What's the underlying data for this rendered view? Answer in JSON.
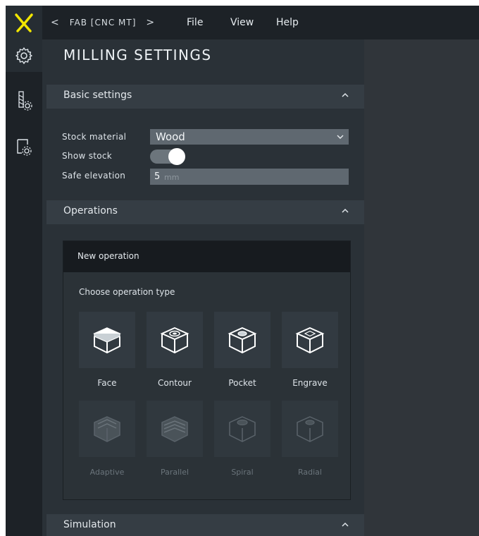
{
  "topbar": {
    "breadcrumb": {
      "prev": "<",
      "label": "FAB [CNC MT]",
      "next": ">"
    },
    "menu": [
      "File",
      "View",
      "Help"
    ]
  },
  "panel": {
    "title": "MILLING SETTINGS",
    "basic": {
      "title": "Basic settings",
      "stock_material_label": "Stock material",
      "stock_material_value": "Wood",
      "show_stock_label": "Show stock",
      "show_stock_on": true,
      "safe_elevation_label": "Safe elevation",
      "safe_elevation_value": "5",
      "safe_elevation_unit": "mm"
    },
    "operations": {
      "title": "Operations",
      "box_title": "New operation",
      "choose_label": "Choose operation type",
      "types": [
        {
          "label": "Face",
          "enabled": true
        },
        {
          "label": "Contour",
          "enabled": true
        },
        {
          "label": "Pocket",
          "enabled": true
        },
        {
          "label": "Engrave",
          "enabled": true
        },
        {
          "label": "Adaptive",
          "enabled": false
        },
        {
          "label": "Parallel",
          "enabled": false
        },
        {
          "label": "Spiral",
          "enabled": false
        },
        {
          "label": "Radial",
          "enabled": false
        }
      ]
    },
    "simulation": {
      "title": "Simulation"
    }
  },
  "colors": {
    "logo": "#f2e600",
    "panel_bg": "#2a3137",
    "section_bg": "#353d44",
    "input_bg": "#5f6870"
  },
  "icons": {
    "logo": "x-logo-icon",
    "rail": [
      "settings-gear-icon",
      "tool-settings-icon",
      "stock-settings-icon"
    ],
    "caret": "chevron-up-icon"
  }
}
